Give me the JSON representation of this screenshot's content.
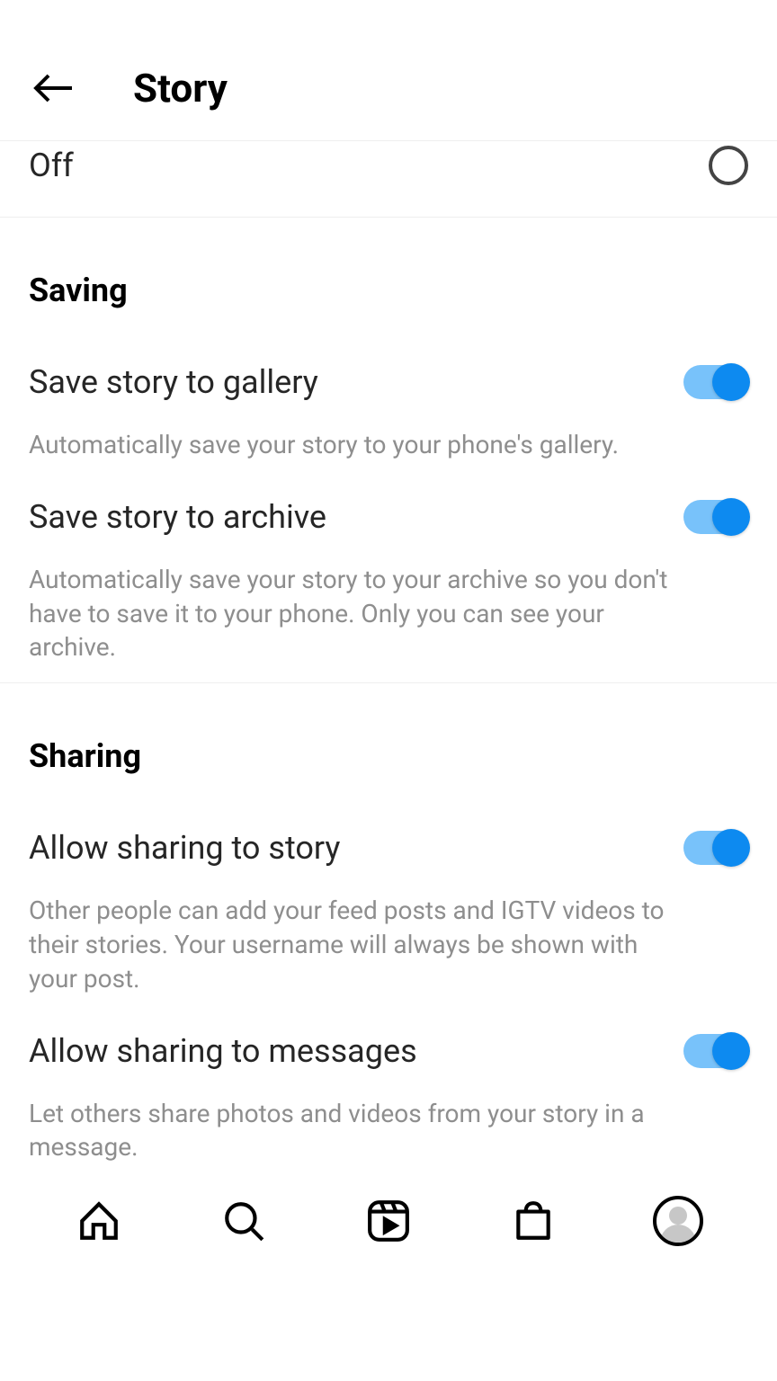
{
  "header": {
    "title": "Story"
  },
  "off_row": {
    "label": "Off"
  },
  "sections": {
    "saving": {
      "title": "Saving",
      "items": [
        {
          "label": "Save story to gallery",
          "desc": "Automatically save your story to your phone's gallery.",
          "enabled": true
        },
        {
          "label": "Save story to archive",
          "desc": "Automatically save your story to your archive so you don't have to save it to your phone. Only you can see your archive.",
          "enabled": true
        }
      ]
    },
    "sharing": {
      "title": "Sharing",
      "items": [
        {
          "label": "Allow sharing to story",
          "desc": "Other people can add your feed posts and IGTV videos to their stories. Your username will always be shown with your post.",
          "enabled": true
        },
        {
          "label": "Allow sharing to messages",
          "desc": "Let others share photos and videos from your story in a message.",
          "enabled": true
        }
      ]
    }
  }
}
